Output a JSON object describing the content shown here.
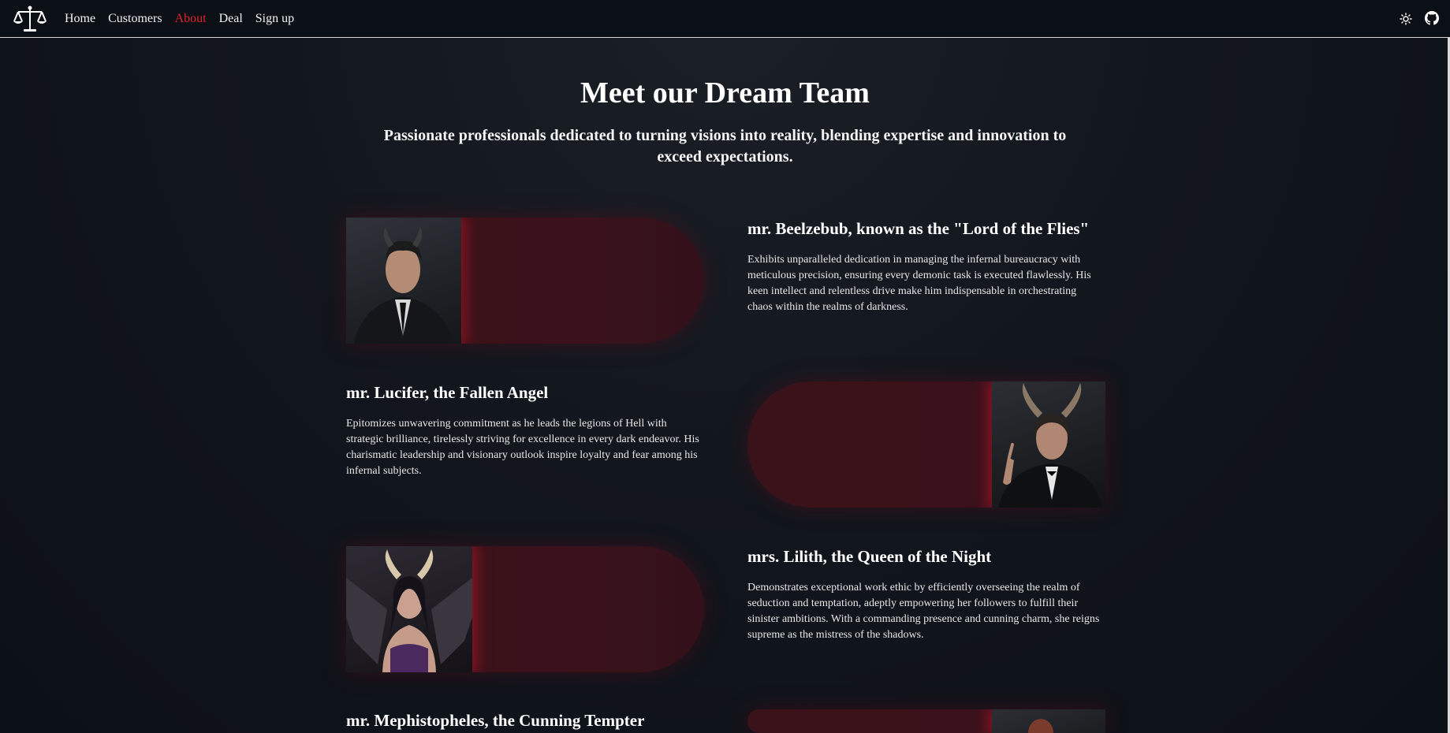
{
  "nav": {
    "links": [
      {
        "label": "Home",
        "active": false
      },
      {
        "label": "Customers",
        "active": false
      },
      {
        "label": "About",
        "active": true
      },
      {
        "label": "Deal",
        "active": false
      },
      {
        "label": "Sign up",
        "active": false
      }
    ],
    "icons": [
      "scales-logo-icon",
      "sun-icon",
      "github-icon"
    ]
  },
  "hero": {
    "title": "Meet our Dream Team",
    "subtitle": "Passionate professionals dedicated to turning visions into reality, blending expertise and innovation to exceed expectations."
  },
  "members": [
    {
      "name": "mr. Beelzebub, known as the \"Lord of the Flies\"",
      "description": "Exhibits unparalleled dedication in managing the infernal bureaucracy with meticulous precision, ensuring every demonic task is executed flawlessly. His keen intellect and relentless drive make him indispensable in orchestrating chaos within the realms of darkness."
    },
    {
      "name": "mr. Lucifer, the Fallen Angel",
      "description": "Epitomizes unwavering commitment as he leads the legions of Hell with strategic brilliance, tirelessly striving for excellence in every dark endeavor. His charismatic leadership and visionary outlook inspire loyalty and fear among his infernal subjects."
    },
    {
      "name": "mrs. Lilith, the Queen of the Night",
      "description": "Demonstrates exceptional work ethic by efficiently overseeing the realm of seduction and temptation, adeptly empowering her followers to fulfill their sinister ambitions. With a commanding presence and cunning charm, she reigns supreme as the mistress of the shadows."
    },
    {
      "name": "mr. Mephistopheles, the Cunning Tempter",
      "description": ""
    }
  ],
  "colors": {
    "accent": "#e5232c",
    "card": "#3a1219",
    "navbar": "#0b0f16"
  }
}
